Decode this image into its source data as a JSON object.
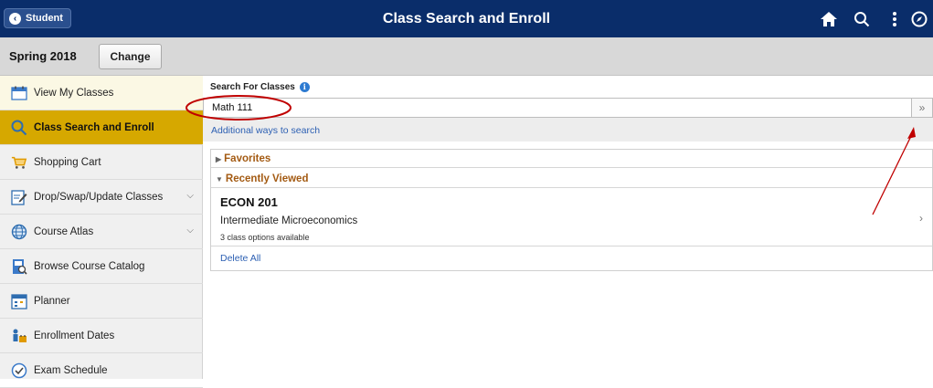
{
  "header": {
    "back_label": "Student",
    "title": "Class Search and Enroll",
    "icons": [
      "home-icon",
      "search-icon",
      "more-vertical-icon",
      "navigator-icon"
    ]
  },
  "term": {
    "label": "Spring 2018",
    "change_label": "Change"
  },
  "sidebar": {
    "items": [
      {
        "label": "View My Classes",
        "icon": "calendar-icon",
        "state": "highlighted"
      },
      {
        "label": "Class Search and Enroll",
        "icon": "search-icon",
        "state": "active"
      },
      {
        "label": "Shopping Cart",
        "icon": "shopping-cart-icon"
      },
      {
        "label": "Drop/Swap/Update Classes",
        "icon": "edit-document-icon",
        "expandable": true
      },
      {
        "label": "Course Atlas",
        "icon": "globe-icon",
        "expandable": true
      },
      {
        "label": "Browse Course Catalog",
        "icon": "catalog-icon"
      },
      {
        "label": "Planner",
        "icon": "planner-icon"
      },
      {
        "label": "Enrollment Dates",
        "icon": "people-icon"
      },
      {
        "label": "Exam Schedule",
        "icon": "clock-icon"
      }
    ]
  },
  "search": {
    "label": "Search For Classes",
    "value": "Math 111",
    "go_symbol": "»",
    "additional_link": "Additional ways to search"
  },
  "favorites": {
    "label": "Favorites"
  },
  "recent": {
    "label": "Recently Viewed",
    "items": [
      {
        "code": "ECON 201",
        "title": "Intermediate Microeconomics",
        "options": "3 class options available"
      }
    ],
    "delete_all": "Delete All"
  },
  "colors": {
    "header_bg": "#0a2d6a",
    "active_nav": "#d6a800",
    "section_heading": "#a35a12",
    "link": "#2d60b3",
    "annotation": "#c00000"
  }
}
